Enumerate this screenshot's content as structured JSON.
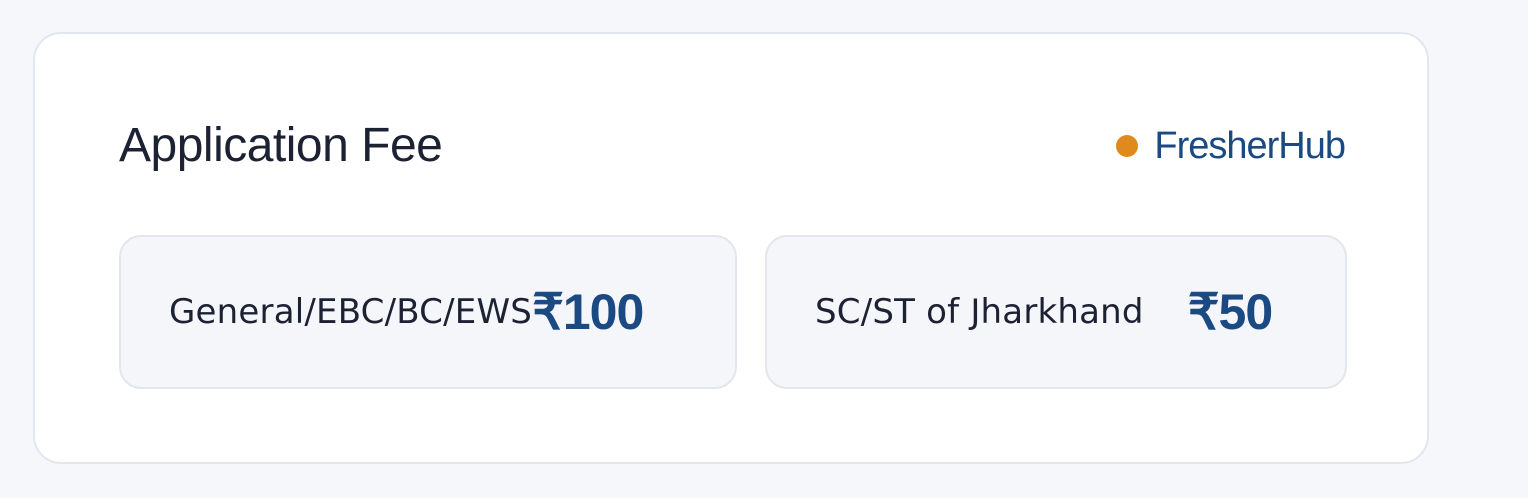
{
  "card": {
    "title": "Application Fee",
    "brand": {
      "name": "FresherHub",
      "dot_color": "#e08a1e",
      "text_color": "#1b4a82"
    }
  },
  "fees": [
    {
      "category": "General/EBC/BC/EWS",
      "amount": "₹100"
    },
    {
      "category": "SC/ST of Jharkhand",
      "amount": "₹50"
    }
  ]
}
